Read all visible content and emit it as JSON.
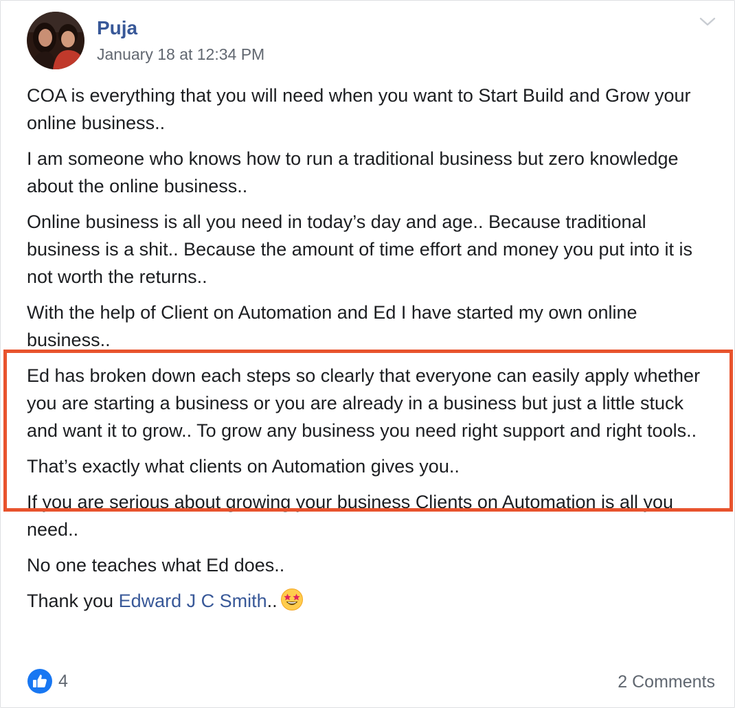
{
  "post": {
    "author": "Puja",
    "timestamp": "January 18 at 12:34 PM",
    "paragraphs": [
      "COA is everything that you will need when you want to Start Build and Grow your online business..",
      "I am someone who knows how to run a traditional business but zero knowledge about the online business..",
      "Online business is all you need in today’s day and age.. Because traditional business is a shit.. Because the amount of time effort and money you put into it is not worth the returns..",
      "With the help of Client on Automation and Ed I have started my own online business..",
      "Ed has broken down each steps so clearly that everyone can easily apply whether you are starting a business or you are already in a business but just a little stuck and want it to grow.. To grow any business you need right support and right tools..",
      "That’s exactly what clients on Automation gives you..",
      "If you are serious about growing your business Clients on Automation is all you need..",
      "No one teaches what Ed does.."
    ],
    "thanks": {
      "prefix": "Thank you ",
      "mention": "Edward J C Smith",
      "suffix": "..",
      "emoji": "star-struck-emoji"
    }
  },
  "footer": {
    "reaction_icon": "like-icon",
    "reaction_count": "4",
    "comments_label": "2 Comments"
  },
  "colors": {
    "link": "#385898",
    "text": "#1c1e21",
    "meta": "#616770",
    "highlight_border": "#e8532d",
    "like_blue": "#1877f2"
  },
  "icons": {
    "menu": "chevron-down-icon",
    "avatar": "profile-photo"
  }
}
